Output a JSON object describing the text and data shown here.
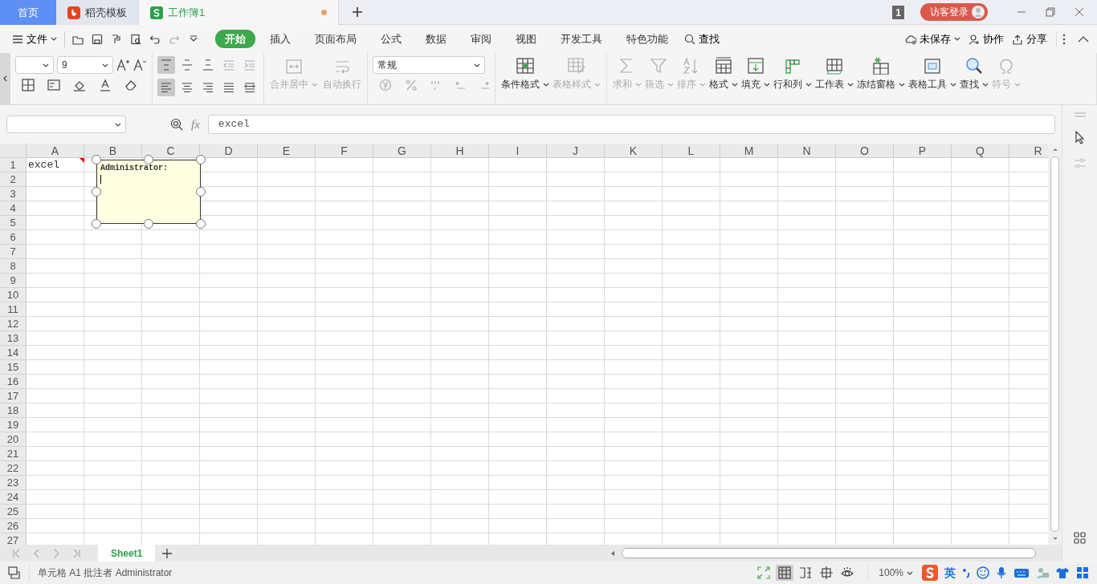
{
  "title_tabs": [
    {
      "kind": "home",
      "label": "首页",
      "selected": false,
      "modified": false
    },
    {
      "kind": "template",
      "label": "稻壳模板",
      "selected": false,
      "modified": false
    },
    {
      "kind": "workbook",
      "label": "工作簿1",
      "selected": true,
      "modified": true
    }
  ],
  "window": {
    "badge": "1",
    "login": "访客登录"
  },
  "menu": {
    "file": "文件",
    "quick_access": [
      {
        "kind": "open",
        "disabled": false
      },
      {
        "kind": "save",
        "disabled": false
      },
      {
        "kind": "painter",
        "disabled": false
      },
      {
        "kind": "preview",
        "disabled": false
      },
      {
        "kind": "undo",
        "disabled": false
      },
      {
        "kind": "redo",
        "disabled": true
      },
      {
        "kind": "more",
        "disabled": false
      }
    ],
    "tabs": [
      {
        "label": "开始",
        "selected": true
      },
      {
        "label": "插入",
        "selected": false
      },
      {
        "label": "页面布局",
        "selected": false
      },
      {
        "label": "公式",
        "selected": false
      },
      {
        "label": "数据",
        "selected": false
      },
      {
        "label": "审阅",
        "selected": false
      },
      {
        "label": "视图",
        "selected": false
      },
      {
        "label": "开发工具",
        "selected": false
      },
      {
        "label": "特色功能",
        "selected": false
      }
    ],
    "search": "查找",
    "actions": [
      {
        "kind": "cloud",
        "label": "未保存",
        "dropdown": true
      },
      {
        "kind": "people",
        "label": "协作",
        "dropdown": false
      },
      {
        "kind": "share",
        "label": "分享",
        "dropdown": false
      }
    ]
  },
  "ribbon": {
    "font_size": "9",
    "align_buttons": [
      {
        "kind": "top",
        "selected": true,
        "disabled": false
      },
      {
        "kind": "middle",
        "selected": false,
        "disabled": false
      },
      {
        "kind": "bottom",
        "selected": false,
        "disabled": false
      },
      {
        "kind": "outdent",
        "selected": false,
        "disabled": true
      },
      {
        "kind": "indent",
        "selected": false,
        "disabled": true
      },
      {
        "kind": "left",
        "selected": true,
        "disabled": false
      },
      {
        "kind": "center",
        "selected": false,
        "disabled": false
      },
      {
        "kind": "right",
        "selected": false,
        "disabled": false
      },
      {
        "kind": "justify",
        "selected": false,
        "disabled": false
      },
      {
        "kind": "distributed",
        "selected": false,
        "disabled": false
      }
    ],
    "merge_buttons": [
      {
        "kind": "merge",
        "label": "合并居中",
        "disabled": true,
        "dropdown": true
      },
      {
        "kind": "wrap",
        "label": "自动换行",
        "disabled": true,
        "dropdown": false
      }
    ],
    "number_format": "常规",
    "tools": [
      {
        "kind": "conditional",
        "label": "条件格式",
        "disabled": false
      },
      {
        "kind": "table-style",
        "label": "表格样式",
        "disabled": true
      },
      {
        "kind": "sum",
        "label": "求和",
        "disabled": true
      },
      {
        "kind": "filter",
        "label": "筛选",
        "disabled": true
      },
      {
        "kind": "sort",
        "label": "排序",
        "disabled": true
      },
      {
        "kind": "format",
        "label": "格式",
        "disabled": false
      },
      {
        "kind": "fill",
        "label": "填充",
        "disabled": false
      },
      {
        "kind": "rowcol",
        "label": "行和列",
        "disabled": false
      },
      {
        "kind": "sheet",
        "label": "工作表",
        "disabled": false
      },
      {
        "kind": "freeze",
        "label": "冻结窗格",
        "disabled": false
      },
      {
        "kind": "table-tools",
        "label": "表格工具",
        "disabled": false
      },
      {
        "kind": "find",
        "label": "查找",
        "disabled": false
      },
      {
        "kind": "symbol",
        "label": "符号",
        "disabled": true
      }
    ]
  },
  "formula_bar": {
    "fx": "fx",
    "value": "excel"
  },
  "sheet": {
    "columns": [
      "A",
      "B",
      "C",
      "D",
      "E",
      "F",
      "G",
      "H",
      "I",
      "J",
      "K",
      "L",
      "M",
      "N",
      "O",
      "P",
      "Q",
      "R"
    ],
    "rows": [
      "1",
      "2",
      "3",
      "4",
      "5",
      "6",
      "7",
      "8",
      "9",
      "10",
      "11",
      "12",
      "13",
      "14",
      "15",
      "16",
      "17",
      "18",
      "19",
      "20",
      "21",
      "22",
      "23",
      "24",
      "25",
      "26",
      "27"
    ],
    "cells": [
      {
        "text": "excel",
        "has_comment": true
      }
    ],
    "comment": {
      "author": "Administrator:"
    }
  },
  "sheet_tabs": [
    {
      "label": "Sheet1",
      "selected": true
    }
  ],
  "status_bar": {
    "text": "单元格 A1 批注者 Administrator",
    "views": [
      {
        "kind": "fullscreen",
        "selected": false
      },
      {
        "kind": "normal",
        "selected": true
      },
      {
        "kind": "pagebreak",
        "selected": false
      },
      {
        "kind": "layout",
        "selected": false
      },
      {
        "kind": "eye",
        "selected": false
      }
    ],
    "zoom": "100%",
    "ime": "英"
  }
}
